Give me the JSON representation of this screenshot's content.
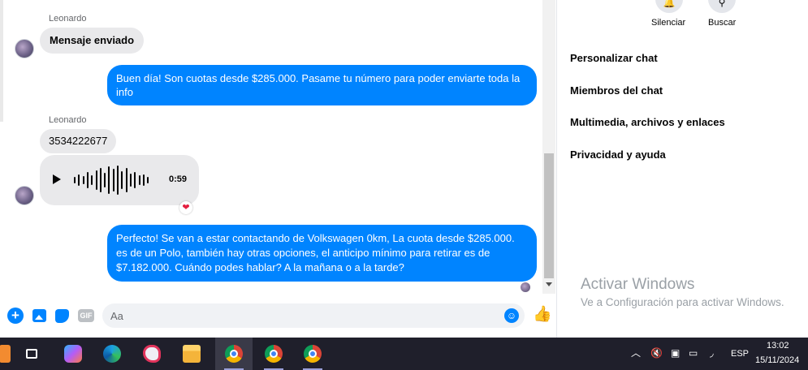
{
  "conversation": {
    "messages": [
      {
        "sender": "Leonardo",
        "text": "Mensaje enviado"
      },
      {
        "text": "Buen día! Son cuotas desde $285.000. Pasame tu número para poder enviarte toda la info"
      },
      {
        "sender": "Leonardo",
        "text": "3534222677"
      },
      {
        "audio_duration": "0:59",
        "reaction": "❤"
      },
      {
        "text": "Perfecto!  Se van a estar contactando de Volkswagen 0km, La cuota desde $285.000. es de un Polo, también hay otras opciones, el anticipo mínimo para retirar es de $7.182.000. Cuándo podes hablar? A la mañana o a la tarde?"
      }
    ]
  },
  "composer": {
    "placeholder": "Aa",
    "gif_label": "GIF"
  },
  "right_panel": {
    "actions": [
      {
        "label": "Silenciar",
        "icon": "bell-icon"
      },
      {
        "label": "Buscar",
        "icon": "search-icon"
      }
    ],
    "menu": [
      "Personalizar chat",
      "Miembros del chat",
      "Multimedia, archivos y enlaces",
      "Privacidad y ayuda"
    ]
  },
  "watermark": {
    "title": "Activar Windows",
    "subtitle": "Ve a Configuración para activar Windows."
  },
  "taskbar": {
    "language": "ESP",
    "time": "13:02",
    "date": "15/11/2024"
  },
  "colors": {
    "outgoing_bubble": "#0084ff",
    "incoming_bubble": "#e9e9eb",
    "taskbar": "#1f1f2b"
  }
}
